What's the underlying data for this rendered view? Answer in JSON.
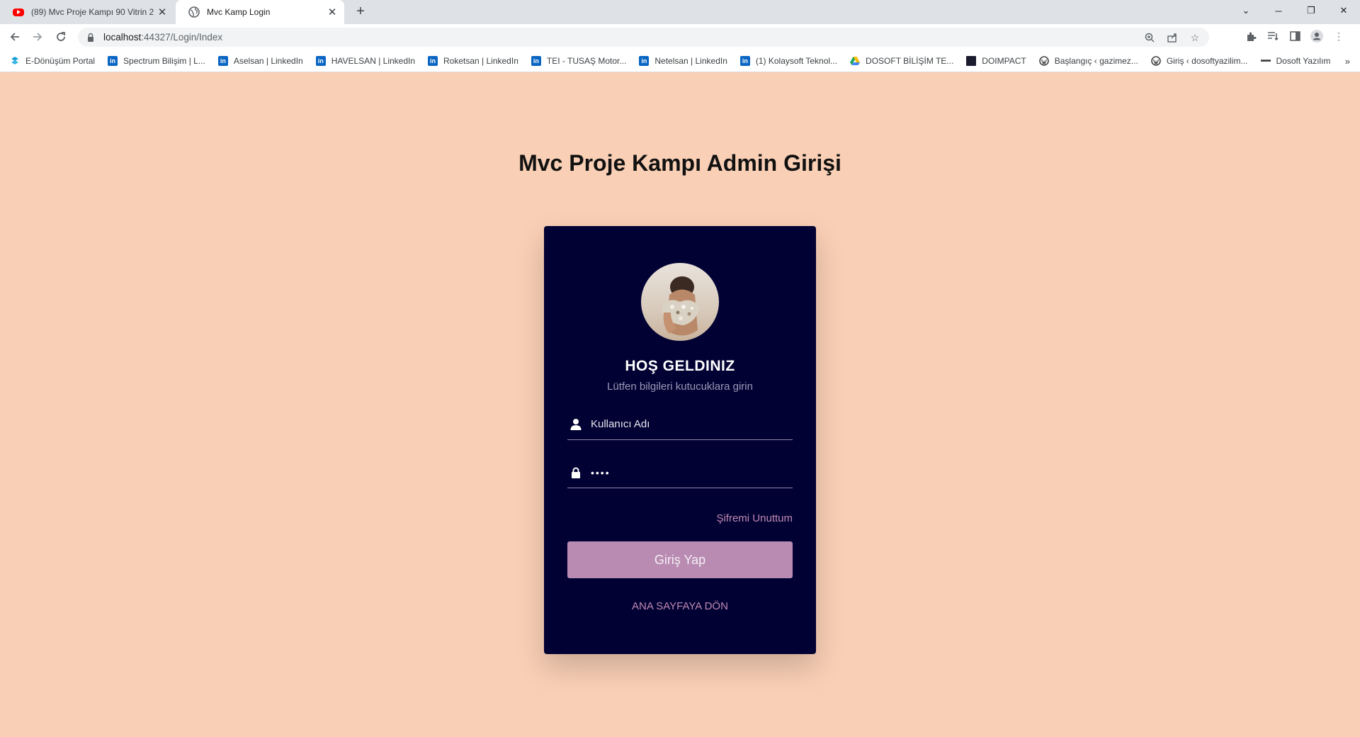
{
  "browser": {
    "tabs": [
      {
        "title": "(89) Mvc Proje Kampı 90 Vitrin 2",
        "favicon": "youtube-icon",
        "active": false
      },
      {
        "title": "Mvc Kamp Login",
        "favicon": "globe-icon",
        "active": true
      }
    ],
    "url_host": "localhost",
    "url_rest": ":44327/Login/Index",
    "bookmarks": [
      {
        "label": "E-Dönüşüm Portal",
        "icon": "edonusum-icon"
      },
      {
        "label": "Spectrum Bilişim | L...",
        "icon": "linkedin-icon"
      },
      {
        "label": "Aselsan | LinkedIn",
        "icon": "linkedin-icon"
      },
      {
        "label": "HAVELSAN | LinkedIn",
        "icon": "linkedin-icon"
      },
      {
        "label": "Roketsan | LinkedIn",
        "icon": "linkedin-icon"
      },
      {
        "label": "TEI - TUSAŞ Motor...",
        "icon": "linkedin-icon"
      },
      {
        "label": "Netelsan | LinkedIn",
        "icon": "linkedin-icon"
      },
      {
        "label": "(1) Kolaysoft Teknol...",
        "icon": "linkedin-icon"
      },
      {
        "label": "DOSOFT BİLİŞİM TE...",
        "icon": "google-drive-icon"
      },
      {
        "label": "DOIMPACT",
        "icon": "doimpact-icon"
      },
      {
        "label": "Başlangıç ‹ gazimez...",
        "icon": "wordpress-icon"
      },
      {
        "label": "Giriş ‹ dosoftyazilim...",
        "icon": "wordpress-icon"
      },
      {
        "label": "Dosoft Yazılım",
        "icon": "dosoft-icon"
      }
    ],
    "bookmarks_more": "»"
  },
  "page": {
    "title": "Mvc Proje Kampı Admin Girişi"
  },
  "login": {
    "welcome": "HOŞ GELDINIZ",
    "subtitle": "Lütfen bilgileri kutucuklara girin",
    "username_placeholder": "Kullanıcı Adı",
    "password_value": "1234",
    "forgot_label": "Şifremi Unuttum",
    "submit_label": "Giriş Yap",
    "back_label": "ANA SAYFAYA DÖN"
  },
  "colors": {
    "page_bg": "#f9cfb5",
    "card_bg": "#010133",
    "accent": "#b98bb2",
    "link": "#c08ab2"
  }
}
